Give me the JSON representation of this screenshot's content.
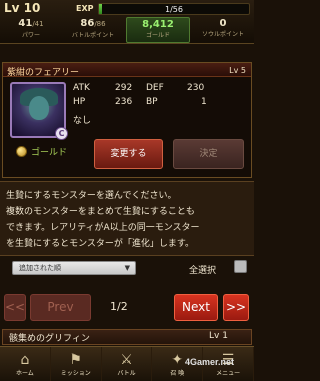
{
  "status": {
    "level": "Lv 10",
    "exp_label": "EXP",
    "exp_text": "1/56",
    "exp_progress": 0.018,
    "stats": [
      {
        "value": "41",
        "max": "/41",
        "label": "パワー"
      },
      {
        "value": "86",
        "max": "/86",
        "label": "バトルポイント"
      },
      {
        "value": "8,412",
        "max": "",
        "label": "ゴールド"
      },
      {
        "value": "0",
        "max": "",
        "label": "ソウルポイント"
      }
    ]
  },
  "card": {
    "name": "紫紺のフェアリー",
    "level": "Lv 5",
    "rarity_badge": "C",
    "atk_label": "ATK",
    "atk": "292",
    "def_label": "DEF",
    "def": "230",
    "hp_label": "HP",
    "hp": "236",
    "bp_label": "BP",
    "bp": "1",
    "skill": "なし",
    "gold_label": "ゴールド",
    "change_label": "変更する",
    "decide_label": "決定"
  },
  "description": {
    "line1": "生贄にするモンスターを選んでください。",
    "line2": "複数のモンスターをまとめて生贄にすることも",
    "line3": "できます。レアリティがA以上の同一モンスター",
    "line4": "を生贄にするとモンスターが「進化」します。"
  },
  "controls": {
    "sort_selected": "追加された順",
    "select_all_label": "全選択"
  },
  "pager": {
    "first_label": "<<",
    "prev_label": "Prev",
    "page": "1/2",
    "next_label": "Next",
    "last_label": ">>"
  },
  "list": {
    "items": [
      {
        "name": "骸集めのグリフィン",
        "level": "Lv  1"
      }
    ]
  },
  "nav": {
    "items": [
      {
        "label": "ホーム",
        "icon": "home-icon"
      },
      {
        "label": "ミッション",
        "icon": "mission-icon"
      },
      {
        "label": "バトル",
        "icon": "battle-icon"
      },
      {
        "label": "召 喚",
        "icon": "summon-icon"
      },
      {
        "label": "メニュー",
        "icon": "menu-icon"
      }
    ]
  },
  "watermark": "4Gamer.net"
}
